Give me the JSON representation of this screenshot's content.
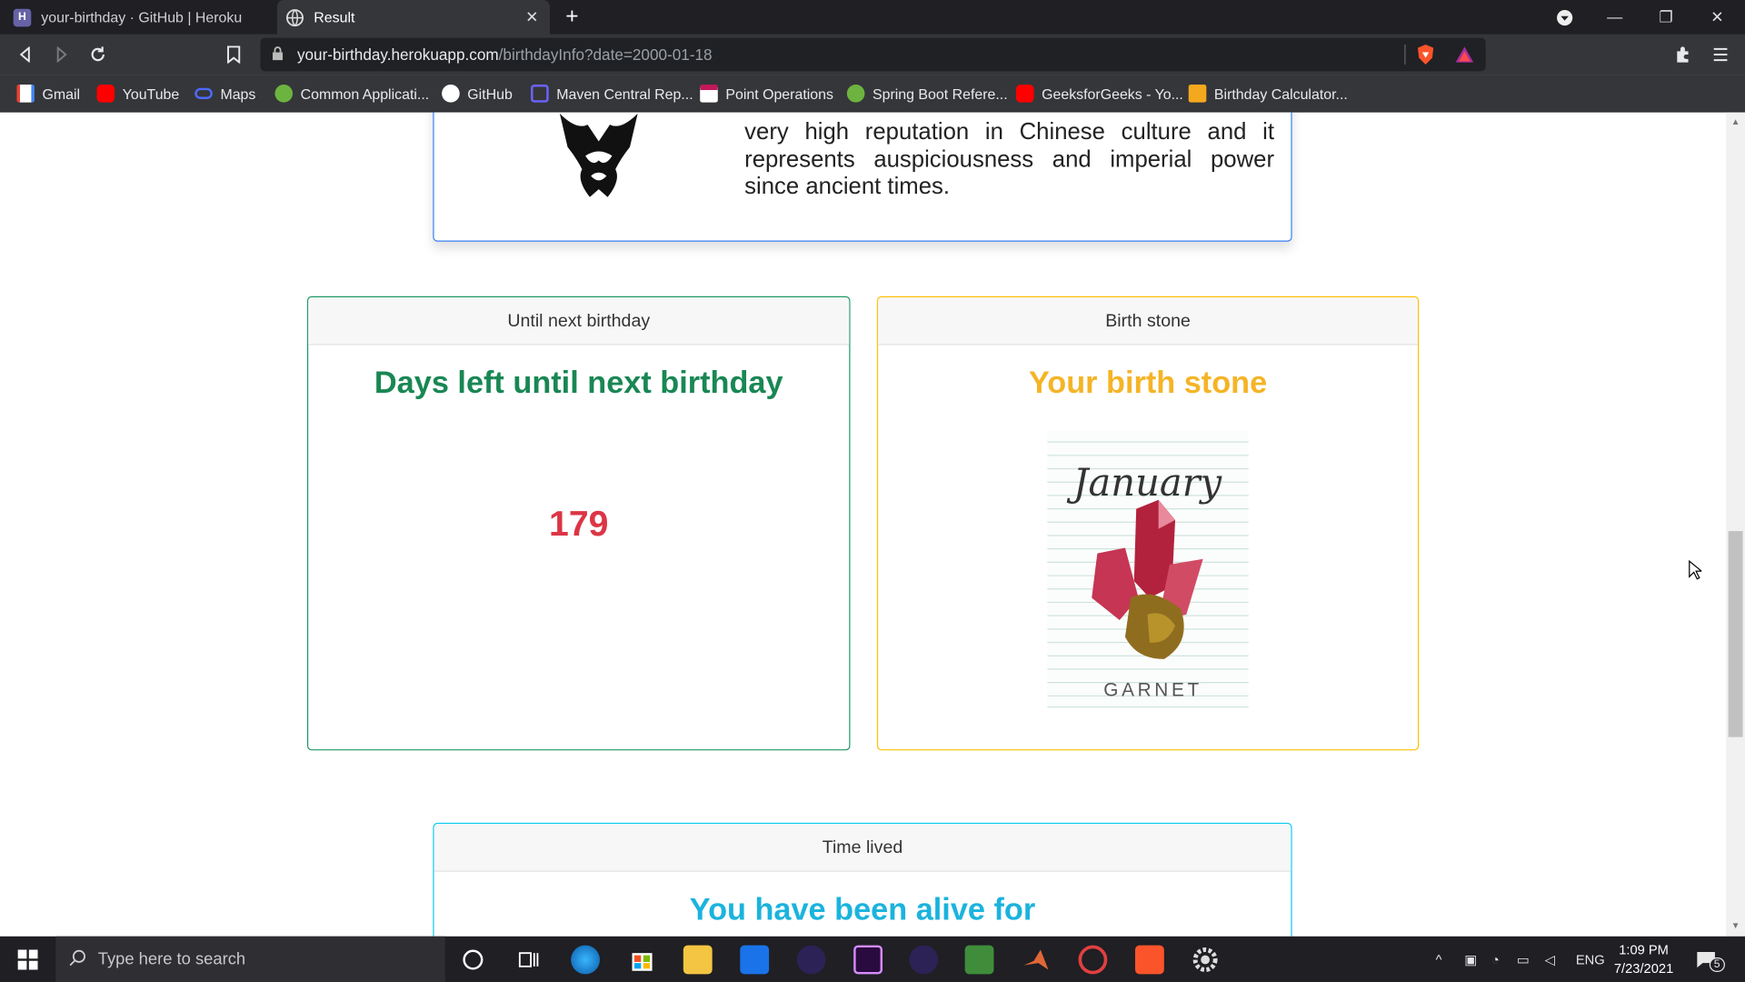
{
  "browser": {
    "tabs": [
      {
        "title": "your-birthday · GitHub | Heroku",
        "active": false
      },
      {
        "title": "Result",
        "active": true
      }
    ],
    "url_host": "your-birthday.herokuapp.com",
    "url_path": "/birthdayInfo?date=2000-01-18",
    "bookmarks": [
      {
        "label": "Gmail",
        "color": "#ea4335"
      },
      {
        "label": "YouTube",
        "color": "#ff0000"
      },
      {
        "label": "Maps",
        "color": "#4d6bfe"
      },
      {
        "label": "Common Applicati...",
        "color": "#6db33f"
      },
      {
        "label": "GitHub",
        "color": "#ffffff"
      },
      {
        "label": "Maven Central Rep...",
        "color": "#6c63ff"
      },
      {
        "label": "Point Operations",
        "color": "#c2185b"
      },
      {
        "label": "Spring Boot Refere...",
        "color": "#6db33f"
      },
      {
        "label": "GeeksforGeeks - Yo...",
        "color": "#ff0000"
      },
      {
        "label": "Birthday Calculator...",
        "color": "#f4a81d"
      }
    ]
  },
  "page": {
    "zodiac_description": "very high reputation in Chinese culture and it represents auspiciousness and imperial power since ancient times.",
    "birthday_card": {
      "header": "Until next birthday",
      "title": "Days left until next birthday",
      "days_left": "179"
    },
    "stone_card": {
      "header": "Birth stone",
      "title": "Your birth stone",
      "image_month_text": "January",
      "image_stone_text": "GARNET"
    },
    "lived_card": {
      "header": "Time lived",
      "title": "You have been alive for"
    }
  },
  "taskbar": {
    "search_placeholder": "Type here to search",
    "language": "ENG",
    "time": "1:09 PM",
    "date": "7/23/2021",
    "notification_count": "5"
  },
  "colors": {
    "birthday_accent": "#198754",
    "days_value": "#dc3545",
    "stone_accent": "#f5b427",
    "lived_accent": "#1bb3dd",
    "zodiac_border": "#3b82f6"
  }
}
